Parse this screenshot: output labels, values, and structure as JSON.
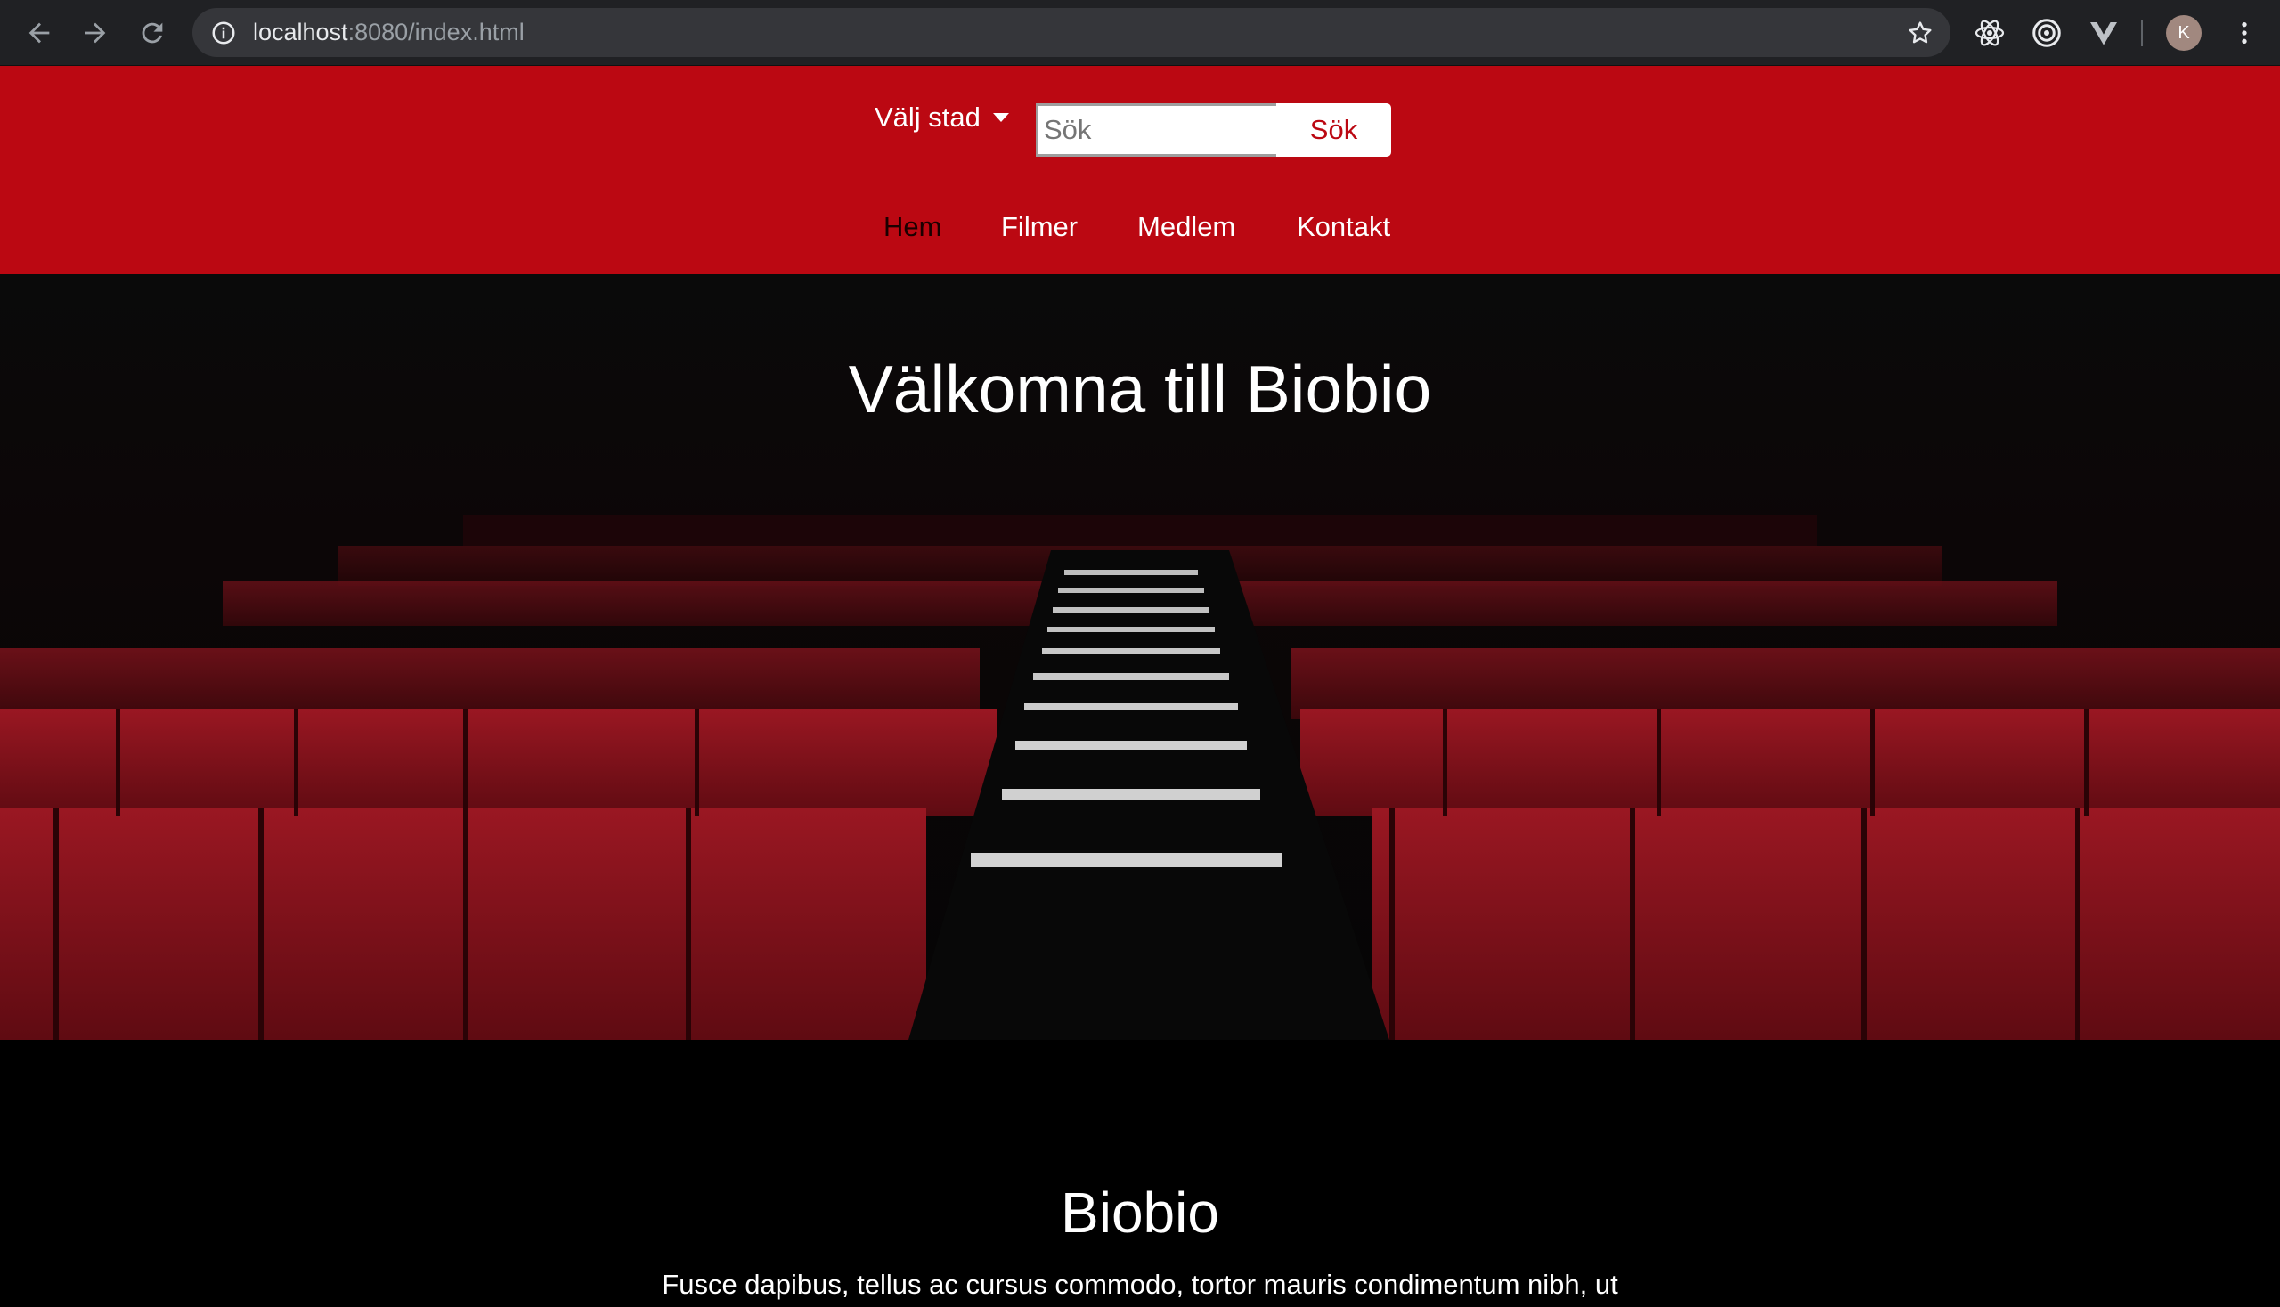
{
  "browser": {
    "url_host": "localhost",
    "url_path": ":8080/index.html",
    "profile_initial": "K"
  },
  "header": {
    "city_label": "Välj stad",
    "search_placeholder": "Sök",
    "search_button": "Sök",
    "nav": [
      "Hem",
      "Filmer",
      "Medlem",
      "Kontakt"
    ],
    "active_nav": "Hem",
    "background_color": "#bb0812"
  },
  "hero": {
    "title": "Välkomna till Biobio"
  },
  "section": {
    "title": "Biobio",
    "text": "Fusce dapibus, tellus ac cursus commodo, tortor mauris condimentum nibh, ut"
  },
  "icons": [
    "back-icon",
    "forward-icon",
    "reload-icon",
    "info-icon",
    "star-icon",
    "react-devtools-icon",
    "target-extension-icon",
    "vue-devtools-icon",
    "menu-icon"
  ]
}
